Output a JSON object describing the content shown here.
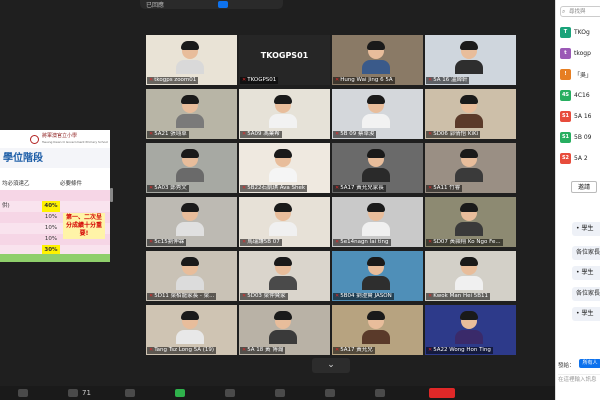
{
  "top_notice": {
    "text": "已回應",
    "button": ""
  },
  "slide": {
    "school_name": "將軍澳官立小學",
    "school_name_en": "Tseung Kwan O Government Primary School",
    "title": "學位階段",
    "rows": [
      {
        "c1": "",
        "c2": "",
        "c3": ""
      },
      {
        "c1": "均必須達乙",
        "c2": "",
        "c3": "必要條件"
      },
      {
        "c1": "",
        "c2": "",
        "c3": ""
      },
      {
        "c1": "供)",
        "c2": "40%",
        "c3": ""
      },
      {
        "c1": "",
        "c2": "10%",
        "c3": ""
      },
      {
        "c1": "",
        "c2": "10%",
        "c3": ""
      },
      {
        "c1": "",
        "c2": "10%",
        "c3": ""
      },
      {
        "c1": "",
        "c2": "30%",
        "c3": ""
      }
    ],
    "callout": "第一、二次呈分成績十分重要!"
  },
  "gallery": {
    "tiles": [
      {
        "name": "tkogps zoom01",
        "active": true,
        "bg": "#e9e3d6",
        "shirt": "#d9d9d9",
        "type": "video"
      },
      {
        "name": "TKOGPS01",
        "active": false,
        "type": "text",
        "big": "TKOGPS01"
      },
      {
        "name": "Hung Wai Jing 6 5A",
        "active": false,
        "bg": "#8a7a66",
        "shirt": "#3a5a8a",
        "type": "video"
      },
      {
        "name": "5A 16 溫綽軒",
        "active": false,
        "bg": "#cfd6dd",
        "shirt": "#2e2e2e",
        "type": "video"
      },
      {
        "name": "5A21 張翊卓",
        "active": false,
        "bg": "#b8b5a6",
        "shirt": "#7a7a7a",
        "type": "video"
      },
      {
        "name": "5A09 馮業希",
        "active": false,
        "bg": "#e6e2d8",
        "shirt": "#f2f2f2",
        "type": "video"
      },
      {
        "name": "5B 09 蔡卓浚",
        "active": false,
        "bg": "#d4d7db",
        "shirt": "#f2f2f2",
        "type": "video"
      },
      {
        "name": "SD06 郭倩怡 KiKi",
        "active": false,
        "bg": "#cdbfa9",
        "shirt": "#5b3a2a",
        "type": "video"
      },
      {
        "name": "5A03 鄭秀文",
        "active": false,
        "bg": "#a7a9a3",
        "shirt": "#6a6a6a",
        "type": "video"
      },
      {
        "name": "5B22石凱琪 Ava Shek",
        "active": false,
        "bg": "#efe9e0",
        "shirt": "#f5f5f5",
        "type": "video"
      },
      {
        "name": "5A17 黃允兒家長",
        "active": false,
        "bg": "#6a6a6a",
        "shirt": "#2a2a2a",
        "type": "video"
      },
      {
        "name": "5A11 竹睿",
        "active": false,
        "bg": "#9a8f84",
        "shirt": "#3a3a3a",
        "type": "video"
      },
      {
        "name": "5c15劉伸霖",
        "active": false,
        "bg": "#bdbab3",
        "shirt": "#e0e0e0",
        "type": "video"
      },
      {
        "name": "馬瑞謙5B 07",
        "active": false,
        "bg": "#e7e1d7",
        "shirt": "#f0f0f0",
        "type": "video"
      },
      {
        "name": "5e14nagn lai ting",
        "active": false,
        "bg": "#c9c9c9",
        "shirt": "#f0f0f0",
        "type": "video"
      },
      {
        "name": "SD07 黃顥翔 Ko Ngo Fe...",
        "active": false,
        "bg": "#8d8a72",
        "shirt": "#3a3a3a",
        "type": "video"
      },
      {
        "name": "5D11 梁栢龍家長 - 梁...",
        "active": false,
        "bg": "#c9c2b6",
        "shirt": "#dcdcdc",
        "type": "video"
      },
      {
        "name": "5D03 梁仲賢家",
        "active": false,
        "bg": "#dad5cc",
        "shirt": "#4a4a4a",
        "type": "video"
      },
      {
        "name": "5B04 劉澄賢 JASON",
        "active": false,
        "bg": "#4f8fb8",
        "shirt": "#2e2e2e",
        "type": "video"
      },
      {
        "name": "Kwok Man Hei 5B11",
        "active": false,
        "bg": "#d3d0c8",
        "shirt": "#f0f0f0",
        "type": "video"
      },
      {
        "name": "Tang Tsz Long 5A (19)",
        "active": false,
        "bg": "#cfc4b3",
        "shirt": "#e8e8e8",
        "type": "video"
      },
      {
        "name": "5A 18 黃 博瀚",
        "active": false,
        "bg": "#b9b2a6",
        "shirt": "#3a3a3a",
        "type": "video"
      },
      {
        "name": "5A17 黃允兒",
        "active": false,
        "bg": "#b7a380",
        "shirt": "#5a3a2a",
        "type": "video"
      },
      {
        "name": "5A22 Wong Hon Ting",
        "active": false,
        "bg": "#2d3a8a",
        "shirt": "#3a2a6a",
        "type": "video"
      }
    ]
  },
  "toolbar": {
    "participants_count": "71"
  },
  "chat": {
    "search_placeholder": "尋找與",
    "channels": [
      {
        "badge": "T",
        "label": "TKOg",
        "color": "#1aa37a"
      },
      {
        "badge": "t",
        "label": "tkogp",
        "color": "#9b59b6"
      },
      {
        "badge": "!",
        "label": "「吳」",
        "color": "#e67e22"
      },
      {
        "badge": "4S",
        "label": "4C16",
        "color": "#27ae60"
      },
      {
        "badge": "S1",
        "label": "5A 16",
        "color": "#e74c3c"
      },
      {
        "badge": "S1",
        "label": "5B 09",
        "color": "#27ae60"
      },
      {
        "badge": "S2",
        "label": "5A 2",
        "color": "#e74c3c"
      }
    ],
    "invite": "邀請",
    "messages": [
      "• 學生",
      "各位家長",
      "• 學生",
      "各位家長",
      "• 學生"
    ],
    "send_to_label": "發給：",
    "send_to_value": "所有人",
    "input_placeholder": "在這裡輸入訊息"
  },
  "colors": {
    "accent": "#0e72ed",
    "active_outline": "#d8d36a",
    "muted_mic": "#e02828"
  }
}
